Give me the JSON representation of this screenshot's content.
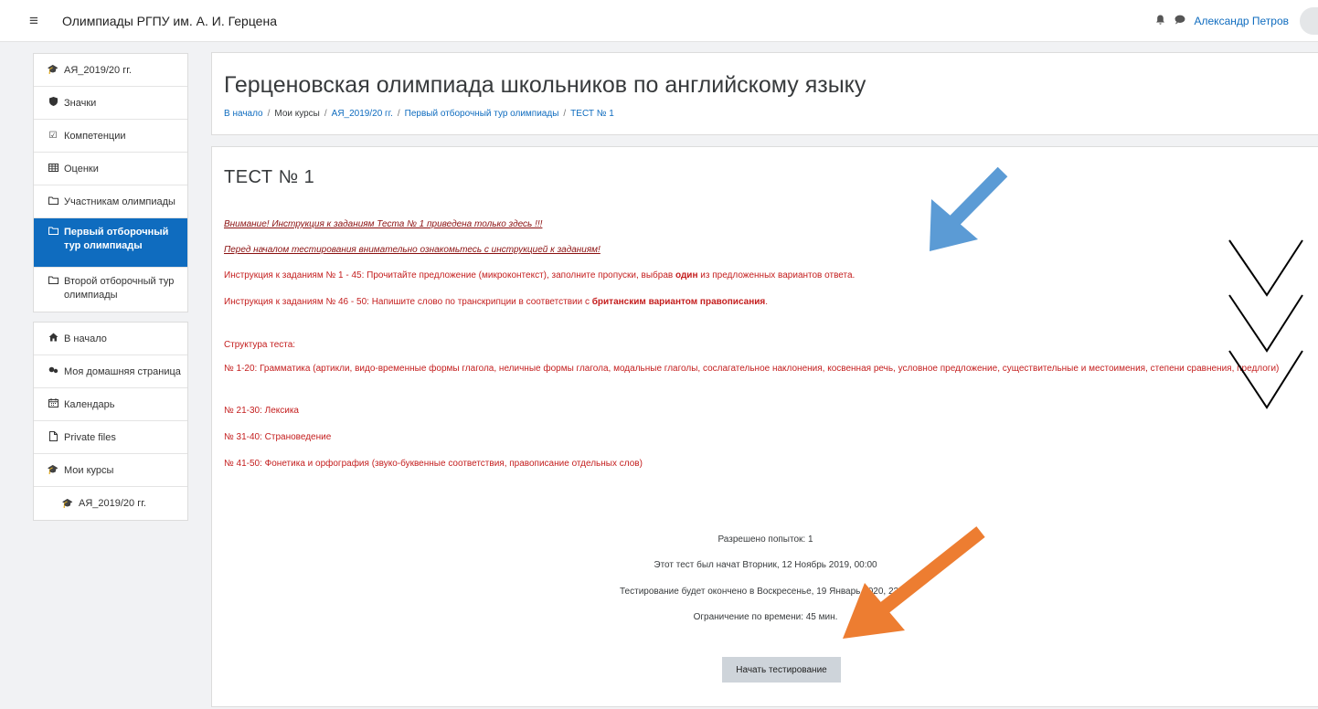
{
  "navbar": {
    "menu_glyph": "≡",
    "site_name": "Олимпиады РГПУ им. А. И. Герцена",
    "user_name": "Александр Петров",
    "bell_glyph": "🔔",
    "chat_glyph": "💬"
  },
  "sidebar": {
    "block1": [
      {
        "icon": "graduation-cap-icon",
        "glyph": "🎓",
        "label": "АЯ_2019/20 гг."
      },
      {
        "icon": "shield-icon",
        "glyph": "🛡",
        "label": "Значки"
      },
      {
        "icon": "check-square-icon",
        "glyph": "☑",
        "label": "Компетенции"
      },
      {
        "icon": "table-icon",
        "glyph": "▦",
        "label": "Оценки"
      },
      {
        "icon": "folder-icon",
        "glyph": "🗀",
        "label": "Участникам олимпиады"
      },
      {
        "icon": "folder-icon",
        "glyph": "🗀",
        "label": "Первый отборочный тур олимпиады"
      },
      {
        "icon": "folder-icon",
        "glyph": "🗀",
        "label": "Второй отборочный тур олимпиады"
      }
    ],
    "block2": [
      {
        "icon": "home-icon",
        "glyph": "🏠",
        "label": "В начало"
      },
      {
        "icon": "dashboard-icon",
        "glyph": "⚙",
        "label": "Моя домашняя страница"
      },
      {
        "icon": "calendar-icon",
        "glyph": "📅",
        "label": "Календарь"
      },
      {
        "icon": "file-icon",
        "glyph": "🗋",
        "label": "Private files"
      },
      {
        "icon": "graduation-cap-icon",
        "glyph": "🎓",
        "label": "Мои курсы"
      },
      {
        "icon": "graduation-cap-icon",
        "glyph": "🎓",
        "label": "АЯ_2019/20 гг."
      }
    ]
  },
  "header": {
    "title": "Герценовская олимпиада школьников по английскому языку",
    "breadcrumb": [
      "В начало",
      "Мои курсы",
      "АЯ_2019/20 гг.",
      "Первый отборочный тур олимпиады",
      "ТЕСТ № 1"
    ]
  },
  "quiz": {
    "title": "ТЕСТ № 1",
    "warning1": "Внимание! Инструкция к заданиям Теста № 1 приведена только здесь !!!",
    "warning2": "Перед началом тестирования внимательно ознакомьтесь с инструкцией к заданиям!",
    "instr1_pre": "Инструкция к заданиям № 1 - 45:  Прочитайте предложение (микроконтекст), заполните пропуски, выбрав ",
    "instr1_bold": "один",
    "instr1_post": " из предложенных вариантов ответа.",
    "instr2_pre": "Инструкция к заданиям № 46 - 50: Напишите слово по транскрипции в соответствии с ",
    "instr2_bold": "британским вариантом правописания",
    "instr2_post": ".",
    "structure_heading": "Структура теста:",
    "structure": [
      "№ 1-20: Грамматика (артикли, видо-временные формы глагола, неличные формы глагола, модальные глаголы, сослагательное наклонения, косвенная речь, условное предложение, существительные и  местоимения, степени сравнения, предлоги)",
      "№ 21-30: Лексика",
      "№ 31-40: Страноведение",
      "№ 41-50: Фонетика и орфография (звуко-буквенные соответствия, правописание отдельных слов)"
    ],
    "attempts": "Разрешено попыток: 1",
    "opened": "Этот тест был начат Вторник, 12 Ноябрь 2019, 00:00",
    "closes": "Тестирование будет окончено в Воскресенье, 19 Январь 2020, 23:59",
    "time_limit": "Ограничение по времени: 45 мин.",
    "start_button": "Начать тестирование"
  },
  "colors": {
    "brand_blue": "#0f6cbf",
    "instruction_red": "#c41e1e",
    "arrow_blue": "#5b9bd5",
    "arrow_orange": "#ed7d31"
  }
}
